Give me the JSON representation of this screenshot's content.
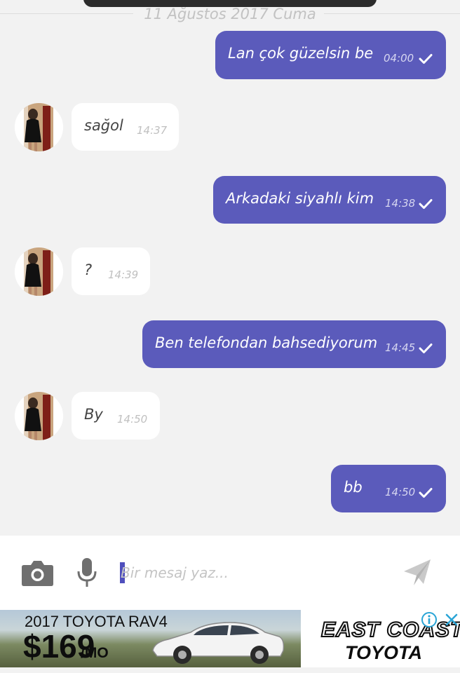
{
  "header": {
    "date": "11 Ağustos 2017 Cuma"
  },
  "messages": [
    {
      "direction": "out",
      "text": "Lan çok güzelsin be",
      "time": "04:00",
      "status_icon": "check-icon"
    },
    {
      "direction": "in",
      "text": "sağol",
      "time": "14:37"
    },
    {
      "direction": "out",
      "text": "Arkadaki siyahlı kim",
      "time": "14:38",
      "status_icon": "check-icon"
    },
    {
      "direction": "in",
      "text": "?",
      "time": "14:39"
    },
    {
      "direction": "out",
      "text": "Ben telefondan bahsediyorum",
      "time": "14:45",
      "status_icon": "check-icon"
    },
    {
      "direction": "in",
      "text": "By",
      "time": "14:50"
    },
    {
      "direction": "out",
      "text": "bb",
      "time": "14:50",
      "status_icon": "check-icon"
    }
  ],
  "composer": {
    "placeholder": "Bir mesaj yaz...",
    "value": "",
    "icons": [
      "camera-icon",
      "microphone-icon",
      "send-icon"
    ]
  },
  "ad": {
    "year_model": "2017 TOYOTA RAV4",
    "price": "$169",
    "price_unit": "/MO",
    "dealer_line1": "EAST COAST",
    "dealer_line2": "TOYOTA",
    "icons": [
      "info-icon",
      "close-icon"
    ]
  },
  "colors": {
    "outgoing_bubble": "#5b5bbb",
    "incoming_bubble": "#ffffff",
    "background": "#f2f2f2",
    "caret": "#4f4fbd"
  }
}
